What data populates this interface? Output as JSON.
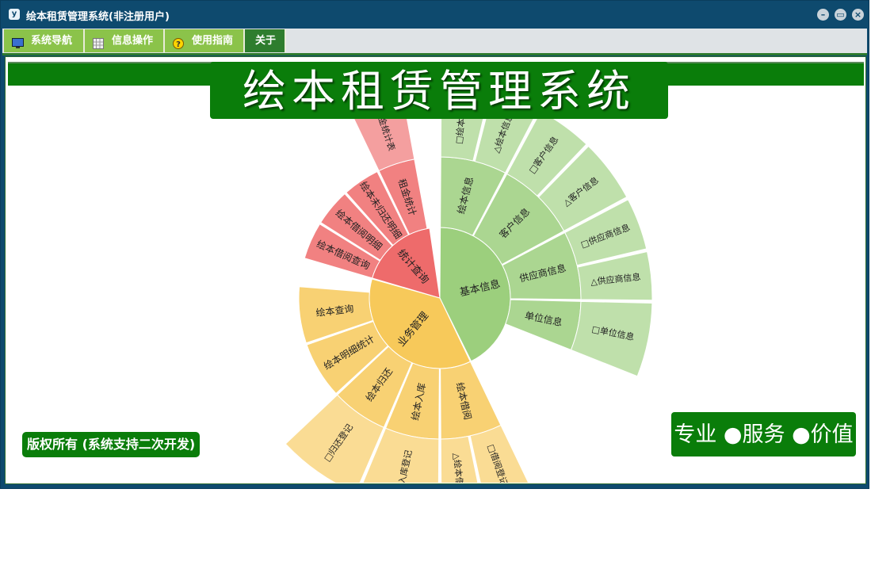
{
  "window": {
    "title": "绘本租赁管理系统(非注册用户)",
    "app_icon": "y"
  },
  "menu": {
    "items": [
      {
        "label": "系统导航",
        "icon": "monitor-icon"
      },
      {
        "label": "信息操作",
        "icon": "grid-icon"
      },
      {
        "label": "使用指南",
        "icon": "help-icon"
      },
      {
        "label": "关于",
        "icon": ""
      }
    ]
  },
  "banner": {
    "title": "绘本租赁管理系统"
  },
  "footer": {
    "copyright": "版权所有 (系统支持二次开发)",
    "slogan": "专业 ●服务 ●价值"
  },
  "colors": {
    "green_dark": "#0a7d0a",
    "menu_green": "#8bc34a",
    "window_blue": "#0e4a6e",
    "sector_green": "#9ccf7d",
    "sector_red": "#ee6b6b",
    "sector_yellow": "#f7c95a"
  },
  "sunburst": [
    {
      "label": "基本信息",
      "color": "#9ccf7d",
      "children": [
        {
          "label": "绘本信息",
          "children": [
            "□绘本信息",
            "△绘本信息"
          ]
        },
        {
          "label": "客户信息",
          "children": [
            "□客户信息",
            "△客户信息"
          ]
        },
        {
          "label": "供应商信息",
          "children": [
            "□供应商信息",
            "△供应商信息"
          ]
        },
        {
          "label": "单位信息",
          "children": [
            "□单位信息"
          ]
        }
      ]
    },
    {
      "label": "业务管理",
      "color": "#f7c95a",
      "children": [
        {
          "label": "绘本借阅",
          "children": [
            "□借阅登记",
            "△绘本借阅"
          ]
        },
        {
          "label": "绘本入库",
          "children": [
            "□入库登记"
          ]
        },
        {
          "label": "绘本归还",
          "children": [
            "□归还登记"
          ]
        },
        {
          "label": "绘本明细统计",
          "children": []
        },
        {
          "label": "绘本查询",
          "children": []
        }
      ]
    },
    {
      "label": "统计查询",
      "color": "#ee6b6b",
      "children": [
        {
          "label": "绘本借阅查询",
          "children": []
        },
        {
          "label": "绘本借阅明细",
          "children": []
        },
        {
          "label": "绘本未归还明细",
          "children": []
        },
        {
          "label": "租金统计",
          "children": [
            "租金统计表"
          ]
        }
      ]
    }
  ]
}
